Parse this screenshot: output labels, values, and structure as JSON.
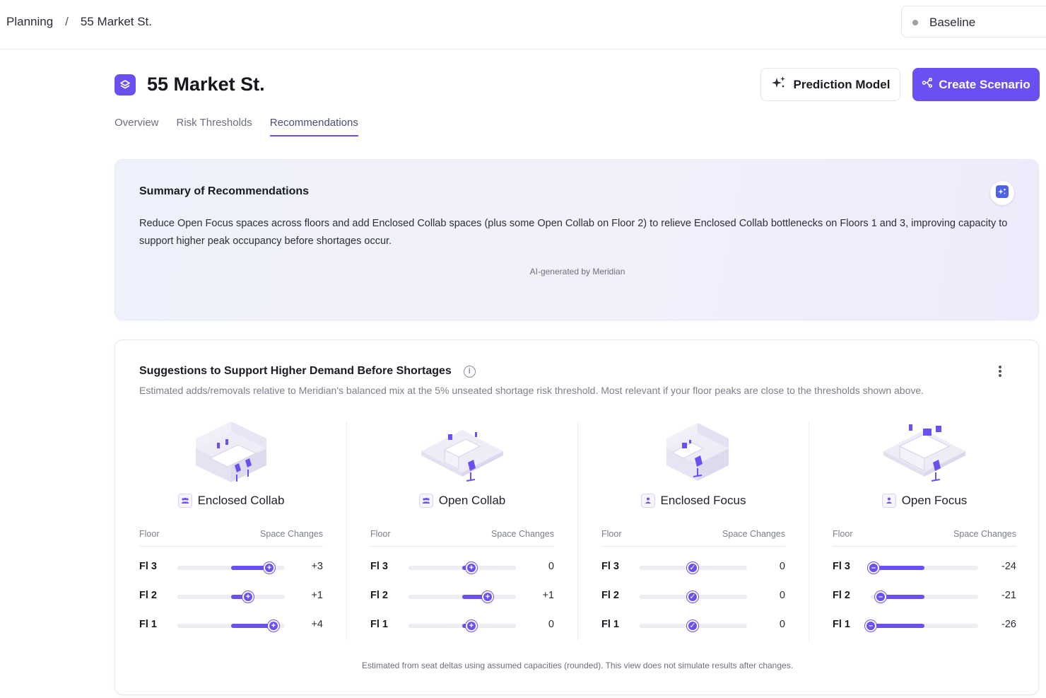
{
  "breadcrumb": {
    "root": "Planning",
    "separator": "/",
    "current": "55 Market St."
  },
  "scenario": {
    "selected": "Baseline"
  },
  "header": {
    "title": "55 Market St.",
    "prediction_label": "Prediction Model",
    "create_label": "Create Scenario"
  },
  "tabs": [
    {
      "label": "Overview",
      "active": false
    },
    {
      "label": "Risk Thresholds",
      "active": false
    },
    {
      "label": "Recommendations",
      "active": true
    }
  ],
  "summary": {
    "title": "Summary of Recommendations",
    "text": "Reduce Open Focus spaces across floors and add Enclosed Collab spaces (plus some Open Collab on Floor 2) to relieve Enclosed Collab bottlenecks on Floors 1 and 3, improving capacity to support higher peak occupancy before shortages occur.",
    "generated_by": "AI-generated by Meridian"
  },
  "suggestions": {
    "title": "Suggestions to Support Higher Demand Before Shortages",
    "subtitle": "Estimated adds/removals relative to Meridian's balanced mix at the 5% unseated shortage risk threshold. Most relevant if your floor peaks are close to the thresholds shown above.",
    "footnote": "Estimated from seat deltas using assumed capacities (rounded). This view does not simulate results after changes.",
    "column_headers": {
      "floor": "Floor",
      "changes": "Space Changes"
    },
    "space_types": [
      {
        "name": "Enclosed Collab",
        "icon": "group-icon",
        "rows": [
          {
            "floor": "Fl 3",
            "change": "+3",
            "value": 3
          },
          {
            "floor": "Fl 2",
            "change": "+1",
            "value": 1
          },
          {
            "floor": "Fl 1",
            "change": "+4",
            "value": 4
          }
        ]
      },
      {
        "name": "Open Collab",
        "icon": "group-icon",
        "rows": [
          {
            "floor": "Fl 3",
            "change": "0",
            "value": 0
          },
          {
            "floor": "Fl 2",
            "change": "+1",
            "value": 1
          },
          {
            "floor": "Fl 1",
            "change": "0",
            "value": 0
          }
        ]
      },
      {
        "name": "Enclosed Focus",
        "icon": "person-icon",
        "rows": [
          {
            "floor": "Fl 3",
            "change": "0",
            "value": 0
          },
          {
            "floor": "Fl 2",
            "change": "0",
            "value": 0
          },
          {
            "floor": "Fl 1",
            "change": "0",
            "value": 0
          }
        ]
      },
      {
        "name": "Open Focus",
        "icon": "person-icon",
        "rows": [
          {
            "floor": "Fl 3",
            "change": "-24",
            "value": -24
          },
          {
            "floor": "Fl 2",
            "change": "-21",
            "value": -21
          },
          {
            "floor": "Fl 1",
            "change": "-26",
            "value": -26
          }
        ]
      }
    ]
  },
  "colors": {
    "accent": "#6b4ff0",
    "track": "#ededf3"
  }
}
